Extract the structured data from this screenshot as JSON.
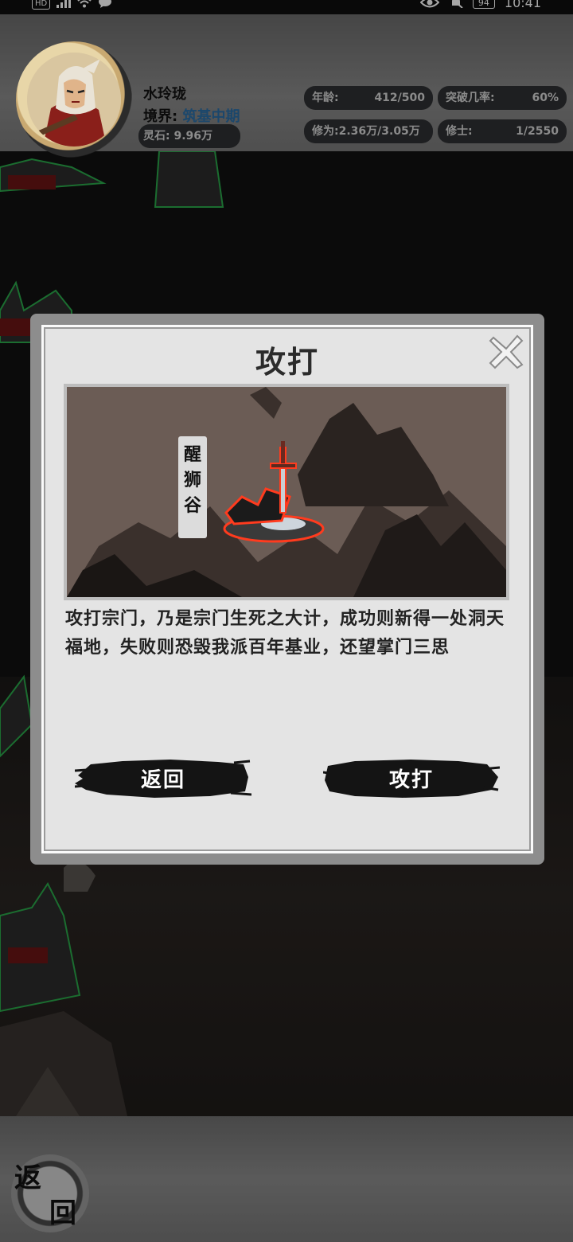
{
  "status_bar": {
    "hd_badge": "HD",
    "battery": "94",
    "time": "10:41"
  },
  "player": {
    "name": "水玲珑",
    "realm_label": "境界:",
    "realm_value": "筑基中期",
    "spirit_stone": "灵石: 9.96万",
    "age_label": "年龄:",
    "age_value": "412/500",
    "breakthrough_label": "突破几率:",
    "breakthrough_value": "60%",
    "cultivation": "修为:2.36万/3.05万",
    "disciples_label": "修士:",
    "disciples_value": "1/2550"
  },
  "dialog": {
    "title": "攻打",
    "location_name": "醒狮谷",
    "description": "攻打宗门，乃是宗门生死之大计，成功则新得一处洞天福地，失败则恐毁我派百年基业，还望掌门三思",
    "back_button": "返回",
    "attack_button": "攻打"
  },
  "bottom_nav": {
    "back_char_1": "返",
    "back_char_2": "回"
  },
  "colors": {
    "header_bg": "#7f7f7f",
    "pill_bg": "#2f3133",
    "realm_accent": "#2a6ea6",
    "modal_bg": "#e4e4e4",
    "glow_red": "#ff3b1e"
  },
  "icons": [
    "close-icon",
    "sword-altar-icon",
    "avatar-portrait"
  ]
}
